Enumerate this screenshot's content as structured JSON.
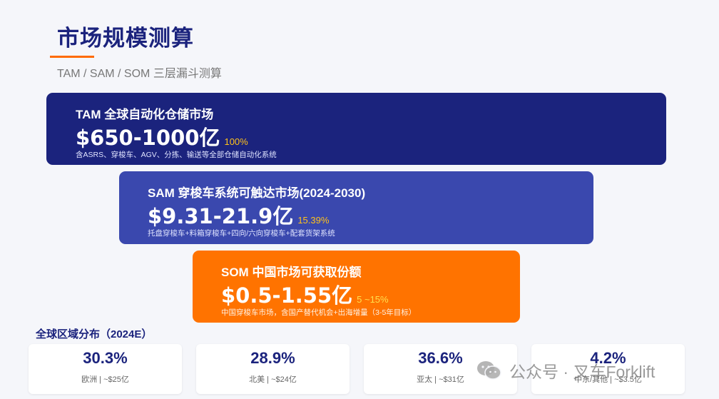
{
  "header": {
    "title": "市场规模测算",
    "subtitle": "TAM / SAM / SOM 三层漏斗测算"
  },
  "funnel": {
    "tam": {
      "heading": "TAM 全球自动化仓储市场",
      "value": "$650-1000亿",
      "percent": "100%",
      "description": "含ASRS、穿梭车、AGV、分拣、输送等全部仓储自动化系统"
    },
    "sam": {
      "heading": "SAM 穿梭车系统可触达市场(2024-2030)",
      "value": "$9.31-21.9亿",
      "percent": "15.39%",
      "description": "托盘穿梭车+料箱穿梭车+四向/六向穿梭车+配套货架系统"
    },
    "som": {
      "heading": "SOM 中国市场可获取份额",
      "value": "$0.5-1.55亿",
      "percent": "5 ~15%",
      "description": "中国穿梭车市场，含国产替代机会+出海增量（3-5年目标）"
    }
  },
  "regions": {
    "title": "全球区域分布（2024E）",
    "cards": [
      {
        "percent": "30.3%",
        "label": "欧洲 | ~$25亿"
      },
      {
        "percent": "28.9%",
        "label": "北美 | ~$24亿"
      },
      {
        "percent": "36.6%",
        "label": "亚太 | ~$31亿"
      },
      {
        "percent": "4.2%",
        "label": "中东/其他 | ~$3.5亿"
      }
    ]
  },
  "watermark": {
    "text": "公众号 · 叉车Forklift",
    "icon": "wechat-icon"
  },
  "colors": {
    "navy": "#1b237d",
    "blue": "#3a48ae",
    "orange": "#ff7300",
    "accent_yellow": "#ffc21a"
  }
}
